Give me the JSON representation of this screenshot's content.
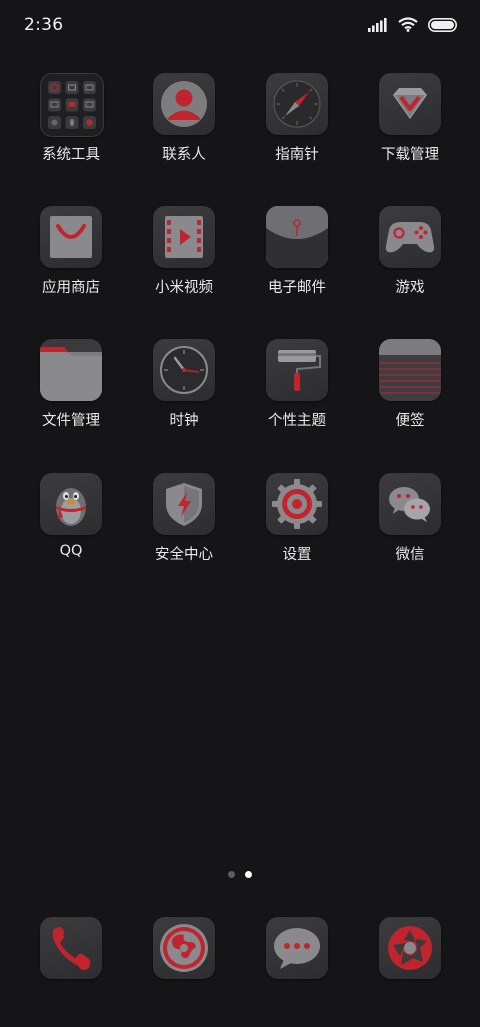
{
  "status_bar": {
    "time": "2:36",
    "icons": [
      "signal-icon",
      "wifi-icon",
      "battery-icon"
    ]
  },
  "apps": [
    {
      "label": "系统工具",
      "icon": "folder-icon"
    },
    {
      "label": "联系人",
      "icon": "contacts-icon"
    },
    {
      "label": "指南针",
      "icon": "compass-icon"
    },
    {
      "label": "下载管理",
      "icon": "download-manager-icon"
    },
    {
      "label": "应用商店",
      "icon": "app-store-icon"
    },
    {
      "label": "小米视频",
      "icon": "video-icon"
    },
    {
      "label": "电子邮件",
      "icon": "email-icon"
    },
    {
      "label": "游戏",
      "icon": "gamepad-icon"
    },
    {
      "label": "文件管理",
      "icon": "file-manager-icon"
    },
    {
      "label": "时钟",
      "icon": "clock-icon"
    },
    {
      "label": "个性主题",
      "icon": "theme-icon"
    },
    {
      "label": "便签",
      "icon": "notes-icon"
    },
    {
      "label": "QQ",
      "icon": "qq-penguin-icon"
    },
    {
      "label": "安全中心",
      "icon": "security-shield-icon"
    },
    {
      "label": "设置",
      "icon": "settings-gear-icon"
    },
    {
      "label": "微信",
      "icon": "wechat-icon"
    }
  ],
  "pager": {
    "pages": 2,
    "current": 2
  },
  "dock": [
    {
      "icon": "phone-icon"
    },
    {
      "icon": "browser-icon"
    },
    {
      "icon": "messages-icon"
    },
    {
      "icon": "camera-icon"
    }
  ],
  "colors": {
    "background": "#151517",
    "icon_tile": "#35353a",
    "accent_red": "#c0242c",
    "icon_grey": "#8a8a8e"
  }
}
